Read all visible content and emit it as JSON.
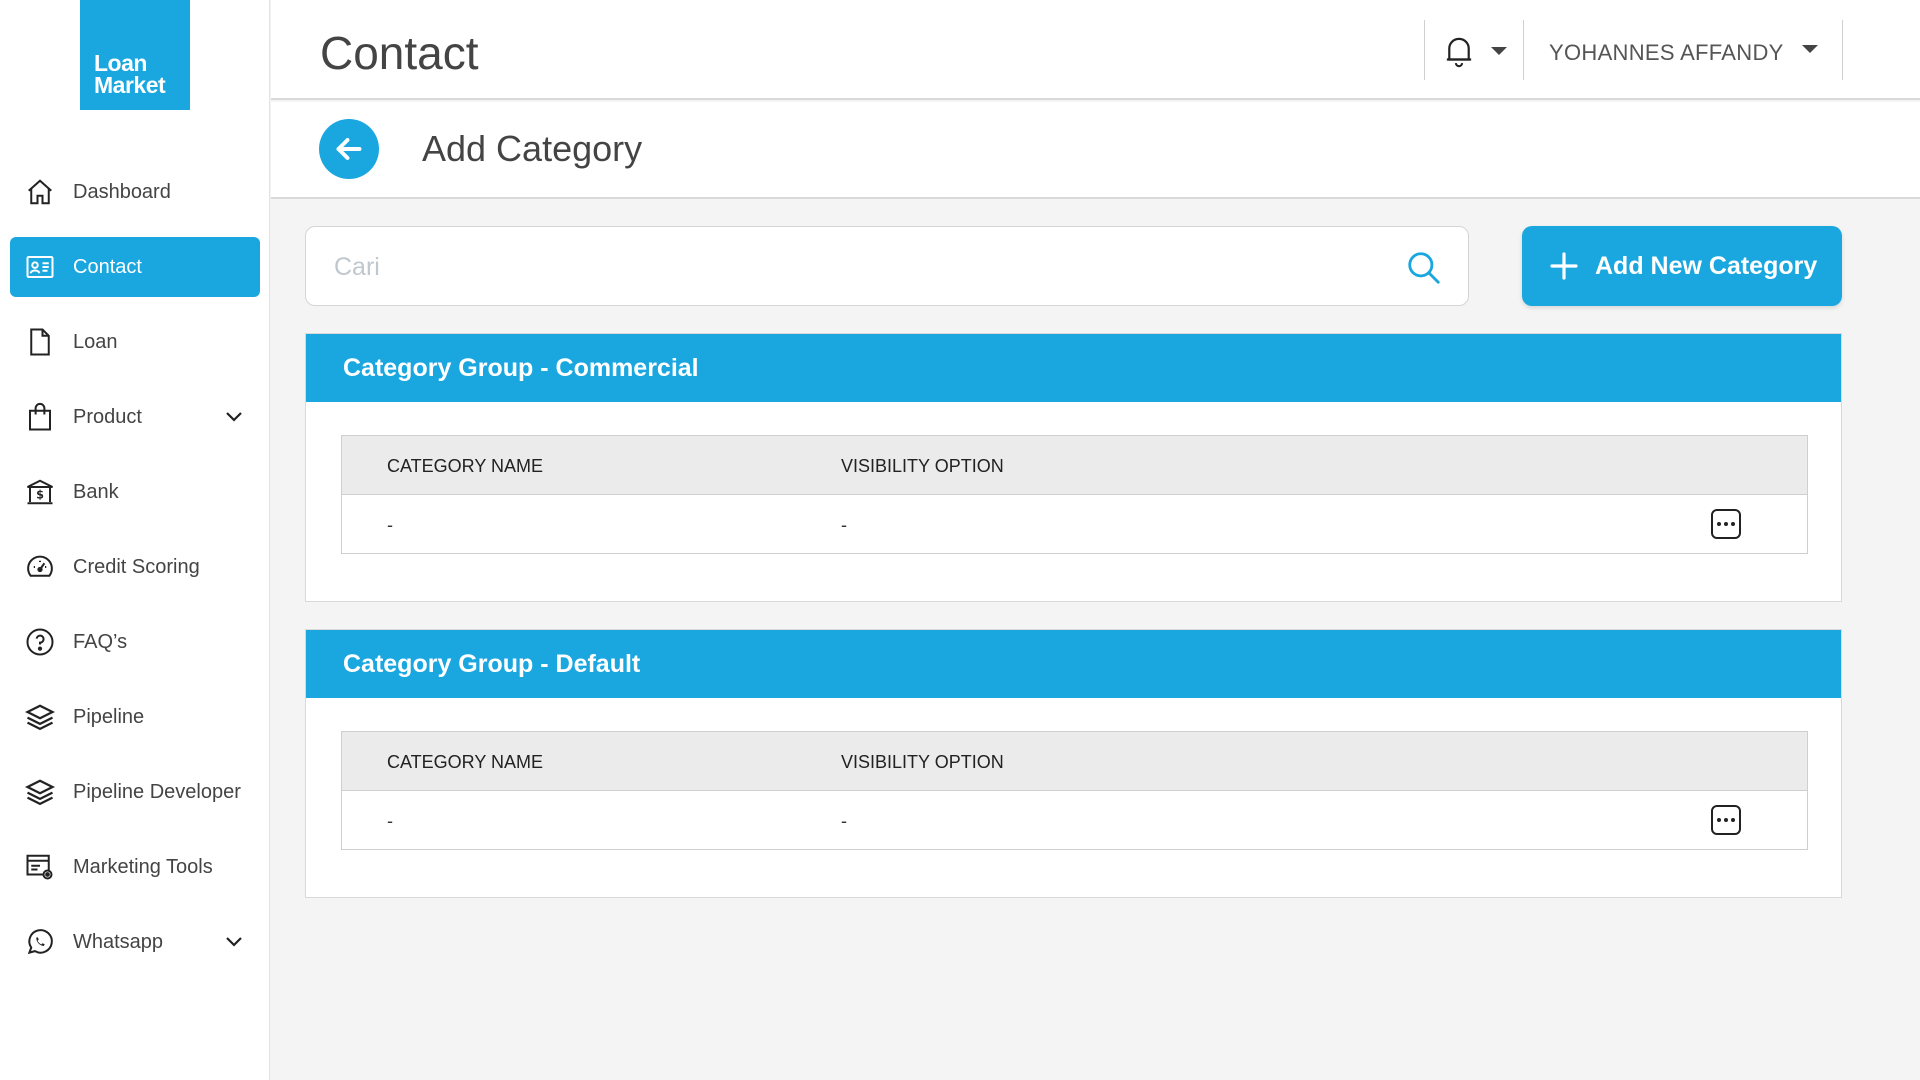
{
  "logo": {
    "line1": "Loan",
    "line2": "Market"
  },
  "sidebar": {
    "items": [
      {
        "label": "Dashboard",
        "icon": "home-icon"
      },
      {
        "label": "Contact",
        "icon": "contact-card-icon",
        "active": true
      },
      {
        "label": "Loan",
        "icon": "document-icon"
      },
      {
        "label": "Product",
        "icon": "shopping-bag-icon",
        "expandable": true
      },
      {
        "label": "Bank",
        "icon": "bank-icon"
      },
      {
        "label": "Credit Scoring",
        "icon": "speedometer-icon"
      },
      {
        "label": "FAQ’s",
        "icon": "question-circle-icon"
      },
      {
        "label": "Pipeline",
        "icon": "layers-icon"
      },
      {
        "label": "Pipeline Developer",
        "icon": "layers-icon"
      },
      {
        "label": "Marketing Tools",
        "icon": "marketing-settings-icon"
      },
      {
        "label": "Whatsapp",
        "icon": "whatsapp-icon",
        "expandable": true
      }
    ]
  },
  "header": {
    "title": "Contact",
    "user_name": "YOHANNES AFFANDY"
  },
  "subheader": {
    "title": "Add Category"
  },
  "search": {
    "placeholder": "Cari",
    "value": ""
  },
  "add_button": {
    "label": "Add New Category"
  },
  "groups": [
    {
      "title": "Category Group - Commercial",
      "columns": [
        "CATEGORY NAME",
        "VISIBILITY OPTION"
      ],
      "rows": [
        [
          "-",
          "-"
        ]
      ]
    },
    {
      "title": "Category Group - Default",
      "columns": [
        "CATEGORY NAME",
        "VISIBILITY OPTION"
      ],
      "rows": [
        [
          "-",
          "-"
        ]
      ]
    }
  ],
  "colors": {
    "accent": "#1aa7e0",
    "background": "#f4f4f4"
  }
}
